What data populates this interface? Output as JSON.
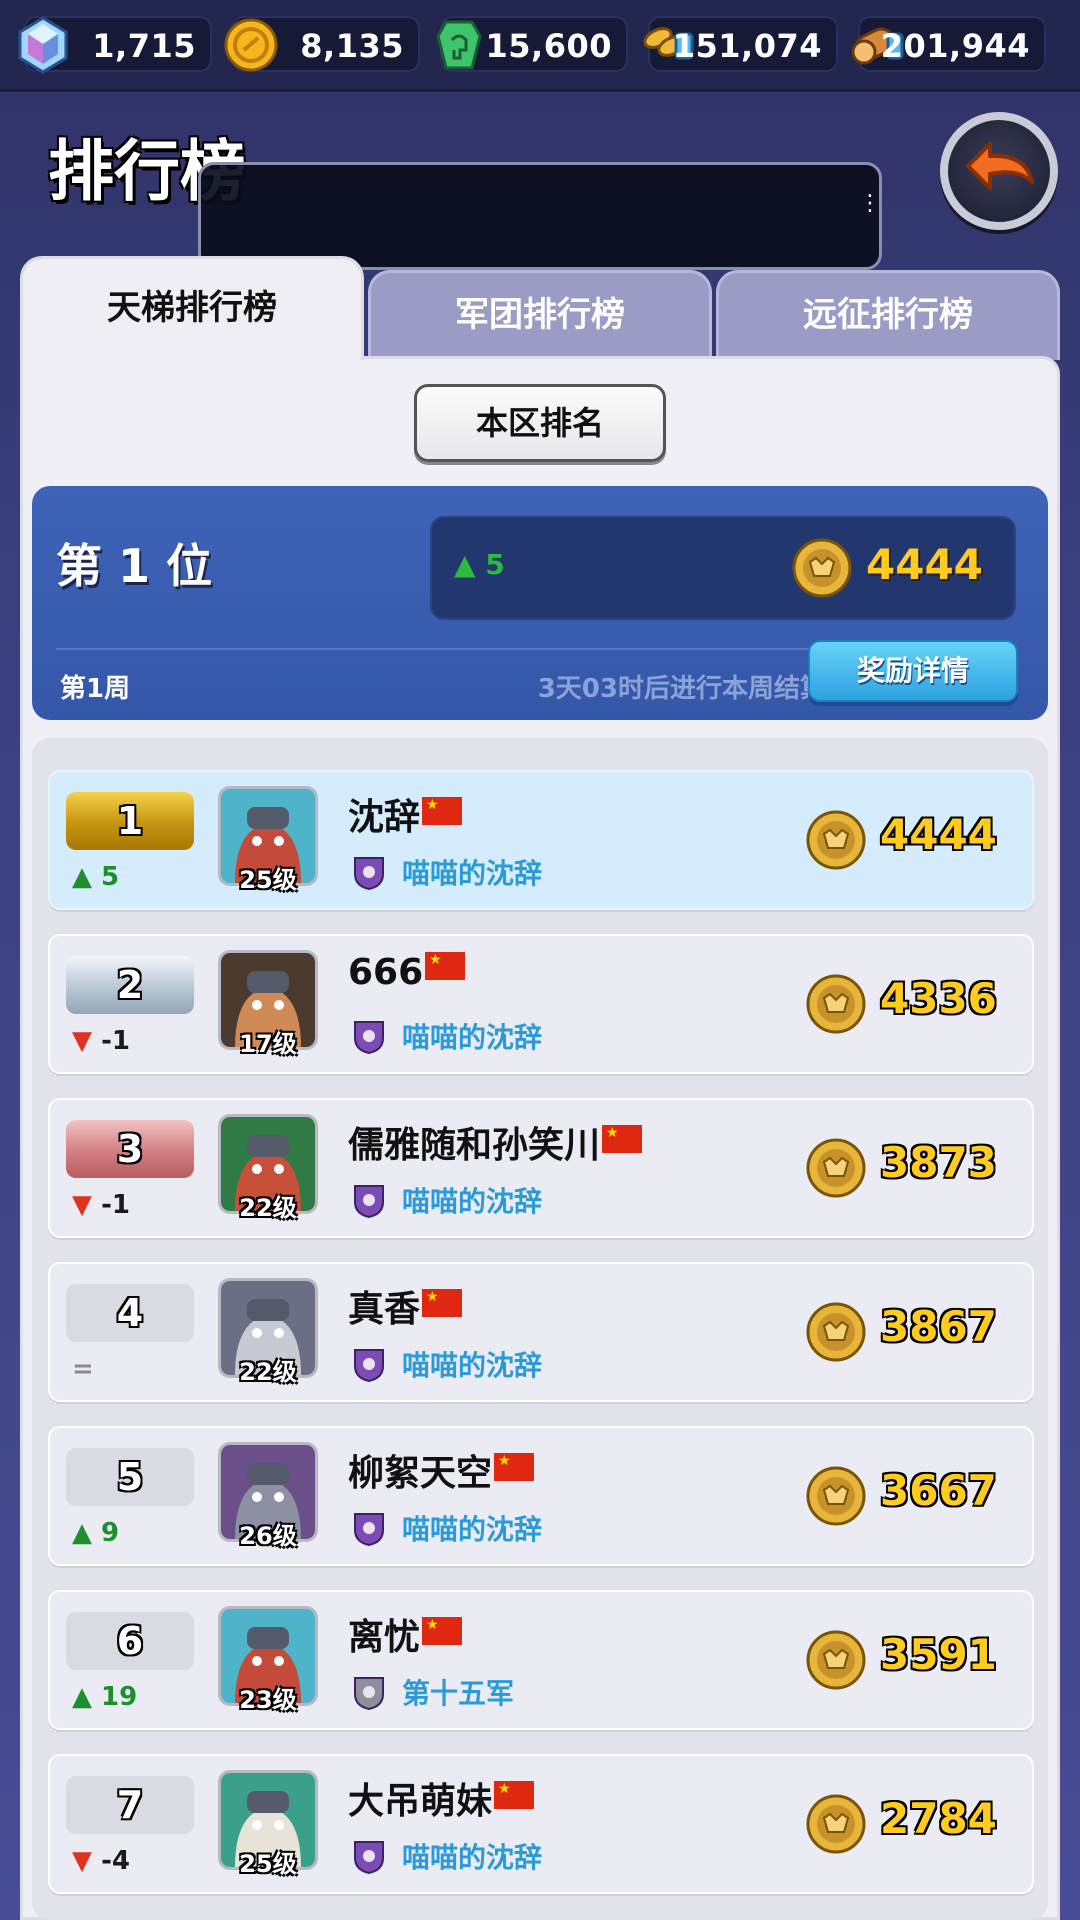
{
  "resources": [
    {
      "name": "crystal-icon",
      "value": "1,715"
    },
    {
      "name": "gold-coin-icon",
      "value": "8,135"
    },
    {
      "name": "green-token-icon",
      "value": "15,600"
    },
    {
      "name": "wheat-icon",
      "value": "151,074"
    },
    {
      "name": "wood-log-icon",
      "value": "201,944"
    }
  ],
  "header": {
    "title": "排行榜"
  },
  "tabs": [
    {
      "label": "天梯排行榜",
      "active": true
    },
    {
      "label": "军团排行榜",
      "active": false
    },
    {
      "label": "远征排行榜",
      "active": false
    }
  ],
  "region_button": "本区排名",
  "my_rank": {
    "position": "第 1 位",
    "change": "5",
    "score": "4444",
    "week": "第1周",
    "settle_text": "3天03时后进行本周结算",
    "reward_button": "奖励详情"
  },
  "rows": [
    {
      "rank": "1",
      "change": "5",
      "change_dir": "up",
      "level": "25级",
      "name": "沈辞",
      "guild": "喵喵的沈辞",
      "score": "4444"
    },
    {
      "rank": "2",
      "change": "-1",
      "change_dir": "down",
      "level": "17级",
      "name": "666",
      "guild": "喵喵的沈辞",
      "score": "4336"
    },
    {
      "rank": "3",
      "change": "-1",
      "change_dir": "down",
      "level": "22级",
      "name": "儒雅随和孙笑川",
      "guild": "喵喵的沈辞",
      "score": "3873"
    },
    {
      "rank": "4",
      "change": "=",
      "change_dir": "same",
      "level": "22级",
      "name": "真香",
      "guild": "喵喵的沈辞",
      "score": "3867"
    },
    {
      "rank": "5",
      "change": "9",
      "change_dir": "up",
      "level": "26级",
      "name": "柳絮天空",
      "guild": "喵喵的沈辞",
      "score": "3667"
    },
    {
      "rank": "6",
      "change": "19",
      "change_dir": "up",
      "level": "23级",
      "name": "离忧",
      "guild": "第十五军",
      "score": "3591"
    },
    {
      "rank": "7",
      "change": "-4",
      "change_dir": "down",
      "level": "25级",
      "name": "大吊萌妹",
      "guild": "喵喵的沈辞",
      "score": "2784"
    }
  ],
  "colors": {
    "background": "#3a3f7e",
    "panel": "#efeff5",
    "my_rank_blue": "#3f63b7",
    "score_gold": "#ffcb1f",
    "guild_blue": "#2b9ad9",
    "up_green": "#1d8f2c",
    "down_red": "#e0331f"
  }
}
